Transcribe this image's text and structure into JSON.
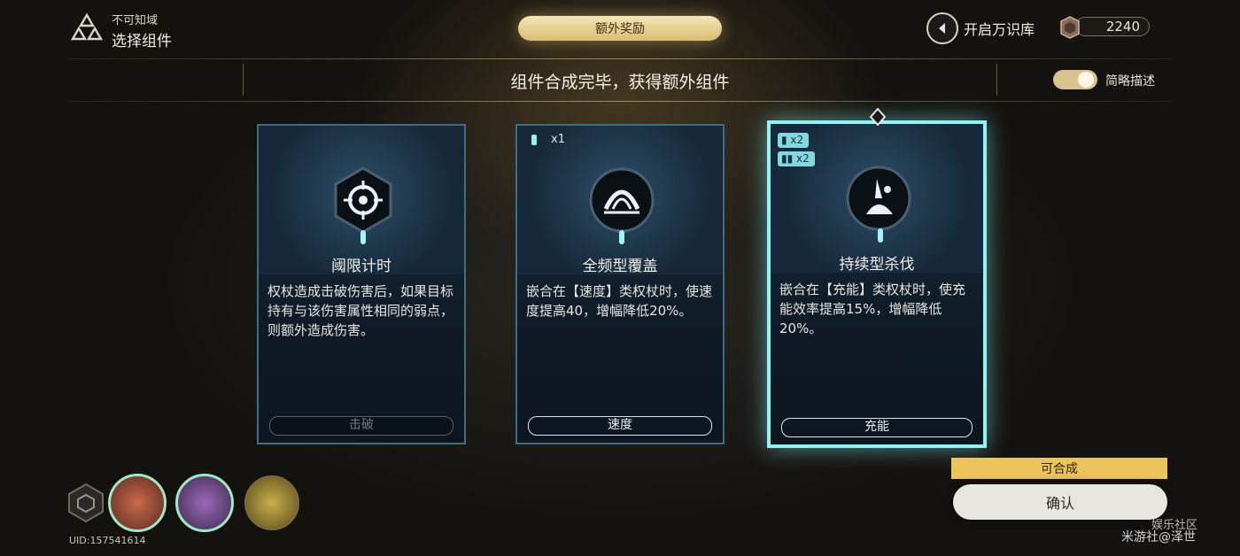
{
  "header": {
    "region_sub": "不可知域",
    "region_title": "选择组件",
    "bonus_tab": "额外奖励",
    "archive_label": "开启万识库",
    "currency_value": "2240"
  },
  "banner": {
    "headline": "组件合成完毕，获得额外组件",
    "toggle_label": "简略描述",
    "toggle_on": true
  },
  "cards": [
    {
      "name": "阈限计时",
      "desc": "权杖造成击破伤害后，如果目标持有与该伤害属性相同的弱点，则额外造成伤害。",
      "tag": "击破",
      "icon": "crosshair-icon"
    },
    {
      "name": "全频型覆盖",
      "desc": "嵌合在【速度】类权杖时，使速度提高40，增幅降低20%。",
      "tag": "速度",
      "badge": "x1",
      "icon": "dome-icon"
    },
    {
      "name": "持续型杀伐",
      "desc": "嵌合在【充能】类权杖时，使充能效率提高15%，增幅降低20%。",
      "tag": "充能",
      "badges": [
        "x2",
        "x2"
      ],
      "icon": "burst-icon",
      "selected": true
    }
  ],
  "footer": {
    "uid": "UID:157541614",
    "merge_label": "可合成",
    "confirm_label": "确认",
    "watermark_1": "米游社@泽世",
    "watermark_2": "娱乐社区"
  },
  "colors": {
    "gold": "#ecc45c",
    "selection": "#8ff4f2",
    "card_border": "#3d6e84"
  }
}
